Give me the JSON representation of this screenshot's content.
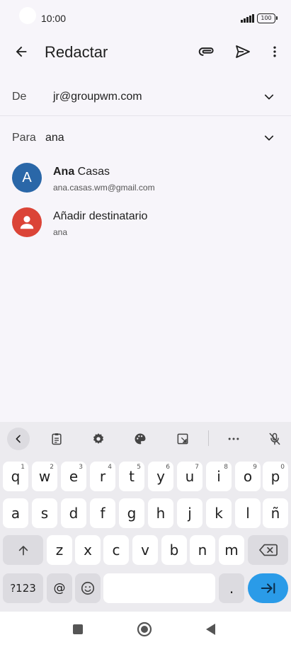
{
  "status": {
    "time": "10:00",
    "battery": "100"
  },
  "appbar": {
    "title": "Redactar"
  },
  "from": {
    "label": "De",
    "value": "jr@groupwm.com"
  },
  "to": {
    "label": "Para",
    "value": "ana"
  },
  "suggestions": [
    {
      "initial": "A",
      "name_bold": "Ana",
      "name_rest": " Casas",
      "email": "ana.casas.wm@gmail.com"
    },
    {
      "name": "Añadir destinatario",
      "sub": "ana"
    }
  ],
  "keyboard": {
    "row1": [
      "q",
      "w",
      "e",
      "r",
      "t",
      "y",
      "u",
      "i",
      "o",
      "p"
    ],
    "row1_hints": [
      "1",
      "2",
      "3",
      "4",
      "5",
      "6",
      "7",
      "8",
      "9",
      "0"
    ],
    "row2": [
      "a",
      "s",
      "d",
      "f",
      "g",
      "h",
      "j",
      "k",
      "l",
      "ñ"
    ],
    "row3": [
      "z",
      "x",
      "c",
      "v",
      "b",
      "n",
      "m"
    ],
    "sym_label": "?123",
    "at_label": "@",
    "period_label": "."
  },
  "colors": {
    "accent": "#2a9be8",
    "avatar_blue": "#2a67a8",
    "avatar_red": "#db4437"
  }
}
